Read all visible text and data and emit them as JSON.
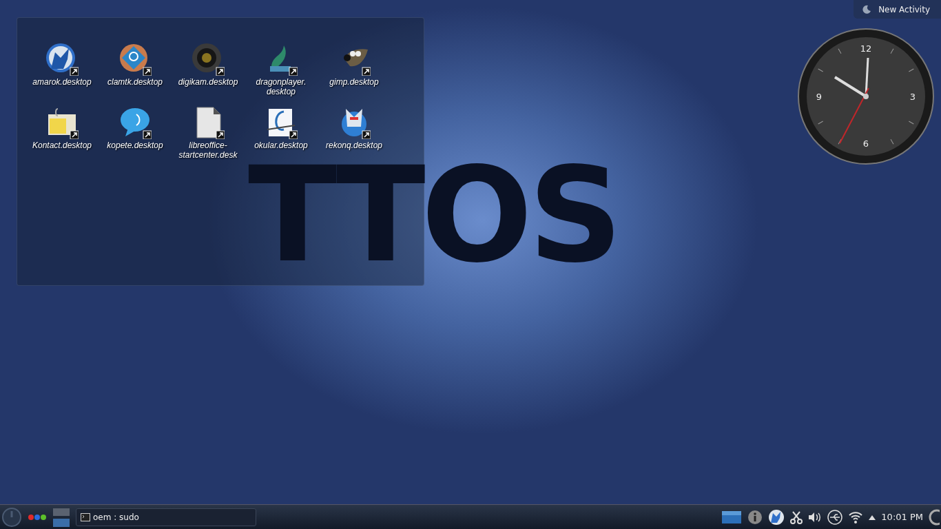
{
  "wallpaper": {
    "logo_text": "TTOS"
  },
  "activity_button": {
    "label": "New Activity"
  },
  "folder_view": {
    "icons": [
      {
        "label": "amarok.desktop",
        "kind": "wolf"
      },
      {
        "label": "clamtk.desktop",
        "kind": "scanner"
      },
      {
        "label": "digikam.desktop",
        "kind": "lens"
      },
      {
        "label": "dragonplayer.desktop",
        "kind": "dragon"
      },
      {
        "label": "gimp.desktop",
        "kind": "gimp"
      },
      {
        "label": "Kontact.desktop",
        "kind": "mail"
      },
      {
        "label": "kopete.desktop",
        "kind": "chat"
      },
      {
        "label": "libreoffice-startcenter.desk",
        "kind": "document"
      },
      {
        "label": "okular.desktop",
        "kind": "reader"
      },
      {
        "label": "rekonq.desktop",
        "kind": "globe"
      }
    ]
  },
  "clock_widget": {
    "numerals": [
      "12",
      "3",
      "6",
      "9"
    ]
  },
  "panel": {
    "task": {
      "label": "oem : sudo",
      "selected": false
    },
    "time": "10:01 PM"
  }
}
